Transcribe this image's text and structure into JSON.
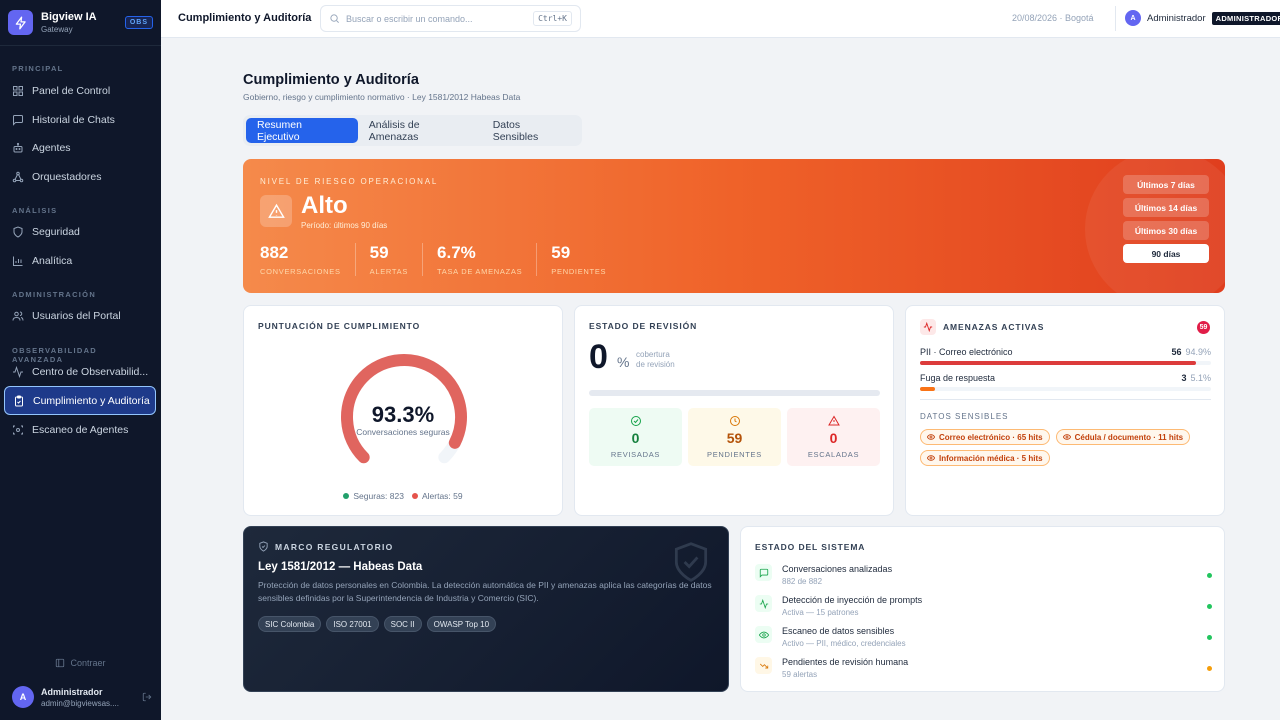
{
  "sidebar": {
    "brand": {
      "name": "Bigview IA",
      "sub": "Gateway",
      "badge": "OBS"
    },
    "sections": [
      {
        "title": "PRINCIPAL",
        "items": [
          {
            "label": "Panel de Control",
            "icon": "grid-icon"
          },
          {
            "label": "Historial de Chats",
            "icon": "chat-icon"
          },
          {
            "label": "Agentes",
            "icon": "bot-icon"
          },
          {
            "label": "Orquestadores",
            "icon": "network-icon"
          }
        ]
      },
      {
        "title": "ANÁLISIS",
        "items": [
          {
            "label": "Seguridad",
            "icon": "shield-icon"
          },
          {
            "label": "Analítica",
            "icon": "bar-chart-icon"
          }
        ]
      },
      {
        "title": "ADMINISTRACIÓN",
        "items": [
          {
            "label": "Usuarios del Portal",
            "icon": "users-icon"
          }
        ]
      },
      {
        "title": "OBSERVABILIDAD AVANZADA",
        "items": [
          {
            "label": "Centro de Observabilid...",
            "icon": "activity-icon"
          },
          {
            "label": "Cumplimiento y Auditoría",
            "icon": "clipboard-icon",
            "active": true
          },
          {
            "label": "Escaneo de Agentes",
            "icon": "scan-icon"
          }
        ]
      }
    ],
    "collapse": "Contraer",
    "user": {
      "initial": "A",
      "name": "Administrador",
      "email": "admin@bigviewsas...."
    }
  },
  "topbar": {
    "title": "Cumplimiento y Auditoría",
    "search_placeholder": "Buscar o escribir un comando...",
    "shortcut": "Ctrl+K",
    "date": "20/08/2026 · Bogotá",
    "user": {
      "initial": "A",
      "name": "Administrador",
      "role": "ADMINISTRADOR"
    }
  },
  "page": {
    "title": "Cumplimiento y Auditoría",
    "subtitle": "Gobierno, riesgo y cumplimiento normativo · Ley 1581/2012 Habeas Data",
    "tabs": [
      {
        "label": "Resumen Ejecutivo",
        "active": true
      },
      {
        "label": "Análisis de Amenazas"
      },
      {
        "label": "Datos Sensibles"
      }
    ]
  },
  "risk": {
    "label": "NIVEL DE RIESGO OPERACIONAL",
    "level": "Alto",
    "period": "Período: últimos 90 días",
    "stats": [
      {
        "value": "882",
        "label": "CONVERSACIONES"
      },
      {
        "value": "59",
        "label": "ALERTAS"
      },
      {
        "value": "6.7%",
        "label": "TASA DE AMENAZAS"
      },
      {
        "value": "59",
        "label": "PENDIENTES"
      }
    ],
    "ranges": [
      {
        "label": "Últimos 7 días"
      },
      {
        "label": "Últimos 14 días"
      },
      {
        "label": "Últimos 30 días"
      },
      {
        "label": "90 días",
        "selected": true
      }
    ]
  },
  "compliance": {
    "title": "PUNTUACIÓN DE CUMPLIMIENTO",
    "score": "93.3%",
    "score_fraction": 0.933,
    "caption": "Conversaciones seguras",
    "legend": [
      {
        "label": "Seguras: 823",
        "color": "#22a06b"
      },
      {
        "label": "Alertas: 59",
        "color": "#e5534b"
      }
    ],
    "arc_color": "#e0655f",
    "track_color": "#f1f5f9"
  },
  "review": {
    "title": "ESTADO DE REVISIÓN",
    "value": "0",
    "unit": "%",
    "caption_1": "cobertura",
    "caption_2": "de revisión",
    "boxes": [
      {
        "value": "0",
        "label": "REVISADAS",
        "icon": "check-circle-icon",
        "bg": "#eefbf3",
        "color": "#15803d"
      },
      {
        "value": "59",
        "label": "PENDIENTES",
        "icon": "clock-icon",
        "bg": "#fef9e8",
        "color": "#b45309"
      },
      {
        "value": "0",
        "label": "ESCALADAS",
        "icon": "alert-triangle-icon",
        "bg": "#fef1f1",
        "color": "#dc2626"
      }
    ]
  },
  "threats": {
    "title": "AMENAZAS ACTIVAS",
    "badge": "59",
    "items": [
      {
        "label": "PII · Correo electrónico",
        "count": "56",
        "pct": "94.9%",
        "fraction": 0.949,
        "color": "#dc3b3b"
      },
      {
        "label": "Fuga de respuesta",
        "count": "3",
        "pct": "5.1%",
        "fraction": 0.051,
        "color": "#f97316"
      }
    ],
    "sensitive_title": "DATOS SENSIBLES",
    "chips": [
      "Correo electrónico · 65 hits",
      "Cédula / documento · 11 hits",
      "Información médica · 5 hits"
    ]
  },
  "regulatory": {
    "title": "MARCO REGULATORIO",
    "law": "Ley 1581/2012 — Habeas Data",
    "description": "Protección de datos personales en Colombia. La detección automática de PII y amenazas aplica las categorías de datos sensibles definidas por la Superintendencia de Industria y Comercio (SIC).",
    "tags": [
      "SIC Colombia",
      "ISO 27001",
      "SOC II",
      "OWASP Top 10"
    ]
  },
  "system": {
    "title": "ESTADO DEL SISTEMA",
    "items": [
      {
        "title": "Conversaciones analizadas",
        "sub": "882 de 882",
        "icon": "message-icon",
        "status": "#22c55e"
      },
      {
        "title": "Detección de inyección de prompts",
        "sub": "Activa — 15 patrones",
        "icon": "pulse-icon",
        "status": "#22c55e"
      },
      {
        "title": "Escaneo de datos sensibles",
        "sub": "Activo — PII, médico, credenciales",
        "icon": "eye-icon",
        "status": "#22c55e"
      },
      {
        "title": "Pendientes de revisión humana",
        "sub": "59 alertas",
        "icon": "trend-down-icon",
        "status": "#f59e0b"
      }
    ]
  }
}
